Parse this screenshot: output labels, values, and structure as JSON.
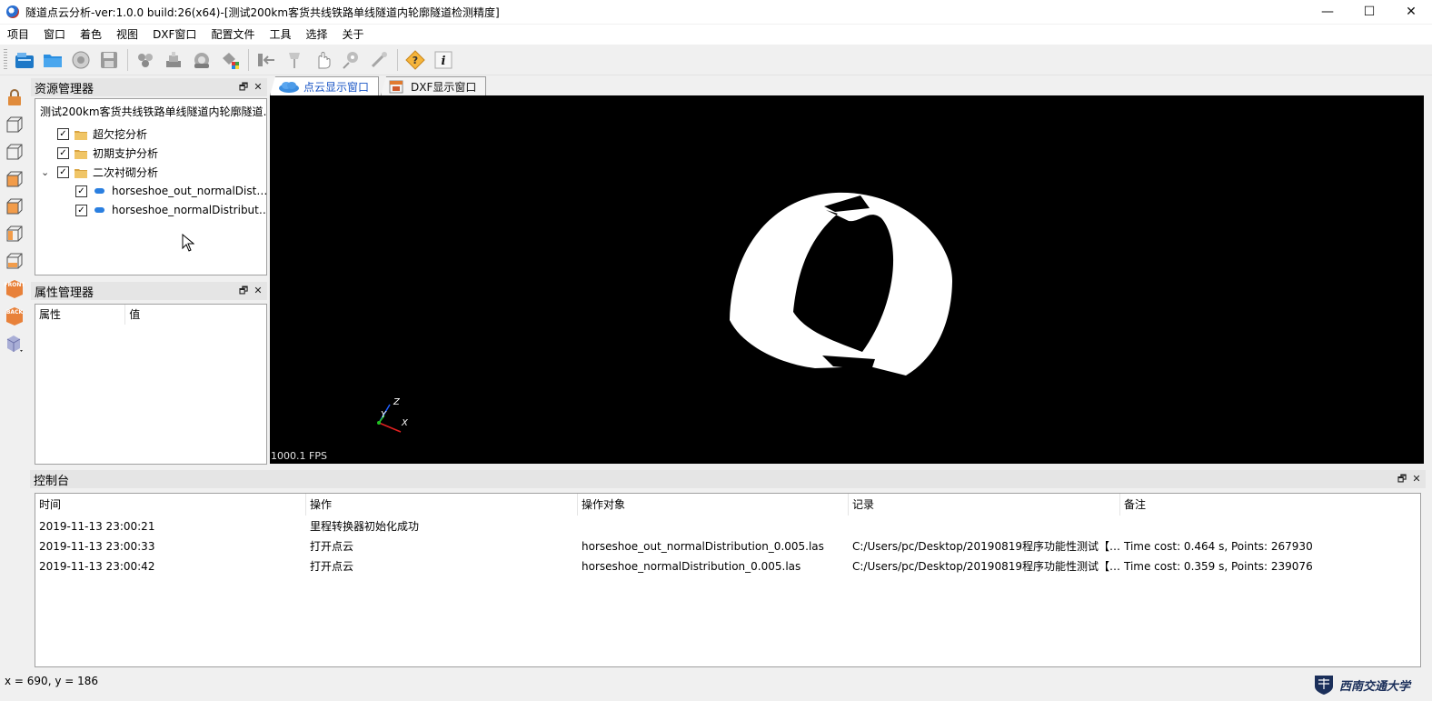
{
  "window": {
    "title": "隧道点云分析-ver:1.0.0 build:26(x64)-[测试200km客货共线铁路单线隧道内轮廓隧道检测精度]",
    "minimize": "—",
    "maximize": "☐",
    "close": "✕"
  },
  "menubar": {
    "items": [
      "项目",
      "窗口",
      "着色",
      "视图",
      "DXF窗口",
      "配置文件",
      "工具",
      "选择",
      "关于"
    ]
  },
  "toolbar": {
    "icons": [
      "new-project-icon",
      "open-folder-icon",
      "disc-icon",
      "save-icon",
      "point-cluster-icon",
      "layers-icon",
      "gear-cloud-icon",
      "color-fill-icon",
      "import-icon",
      "pin-icon",
      "hand-icon",
      "location-icon",
      "tool-icon",
      "help-icon",
      "info-icon"
    ]
  },
  "resource_manager": {
    "title": "资源管理器",
    "root": "测试200km客货共线铁路单线隧道内轮廓隧道…",
    "items": [
      {
        "label": "超欠挖分析",
        "checked": true,
        "level": 1
      },
      {
        "label": "初期支护分析",
        "checked": true,
        "level": 1
      },
      {
        "label": "二次衬砌分析",
        "checked": true,
        "level": 1,
        "expanded": true
      },
      {
        "label": "horseshoe_out_normalDist…",
        "checked": true,
        "level": 2
      },
      {
        "label": "horseshoe_normalDistribut…",
        "checked": true,
        "level": 2
      }
    ]
  },
  "property_manager": {
    "title": "属性管理器",
    "columns": [
      "属性",
      "值"
    ]
  },
  "tabs": [
    {
      "label": "点云显示窗口",
      "active": true
    },
    {
      "label": "DXF显示窗口",
      "active": false
    }
  ],
  "viewport": {
    "fps": "1000.1 FPS",
    "axes": {
      "x": "X",
      "y": "Y",
      "z": "Z"
    }
  },
  "console": {
    "title": "控制台",
    "columns": [
      "时间",
      "操作",
      "操作对象",
      "记录",
      "备注"
    ],
    "rows": [
      [
        "2019-11-13 23:00:21",
        "里程转换器初始化成功",
        "",
        "",
        ""
      ],
      [
        "2019-11-13 23:00:33",
        "打开点云",
        "horseshoe_out_normalDistribution_0.005.las",
        "C:/Users/pc/Desktop/20190819程序功能性测试【…",
        "Time cost: 0.464 s, Points: 267930"
      ],
      [
        "2019-11-13 23:00:42",
        "打开点云",
        "horseshoe_normalDistribution_0.005.las",
        "C:/Users/pc/Desktop/20190819程序功能性测试【…",
        "Time cost: 0.359 s, Points: 239076"
      ]
    ]
  },
  "statusbar": {
    "coordinates": "x = 690, y = 186",
    "logo_text": "西南交通大学"
  },
  "colors": {
    "accent": "#1a56c6",
    "viewport_bg": "#000000",
    "shape_fill": "#ffffff"
  }
}
